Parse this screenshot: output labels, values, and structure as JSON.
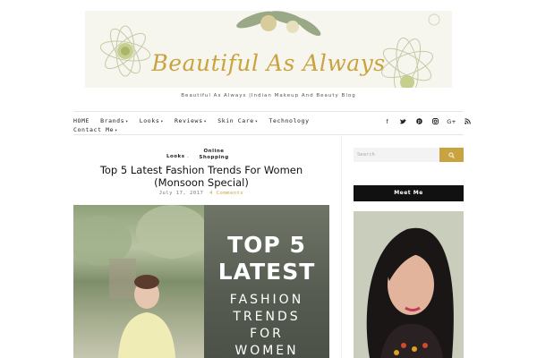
{
  "header": {
    "logo_title": "Beautiful As Always",
    "tagline": "Beautiful As Always |Indian Makeup And Beauty Blog"
  },
  "nav": {
    "row1": [
      {
        "label": "HOME",
        "dropdown": false
      },
      {
        "label": "Brands",
        "dropdown": true
      },
      {
        "label": "Looks",
        "dropdown": true
      },
      {
        "label": "Reviews",
        "dropdown": true
      },
      {
        "label": "Skin Care",
        "dropdown": true
      },
      {
        "label": "Technology",
        "dropdown": false
      }
    ],
    "row2": [
      {
        "label": "Contact Me",
        "dropdown": true
      }
    ],
    "social_icons": [
      "facebook-icon",
      "twitter-icon",
      "pinterest-icon",
      "instagram-icon",
      "google-plus-icon",
      "rss-icon"
    ]
  },
  "post": {
    "categories": [
      "Looks",
      "Online Shopping"
    ],
    "title": "Top 5 Latest Fashion Trends For Women (Monsoon Special)",
    "date": "July 17, 2017",
    "comments": "4 Comments",
    "image_text": [
      "TOP 5",
      "LATEST",
      "FASHION",
      "TRENDS",
      "FOR",
      "WOMEN"
    ]
  },
  "sidebar": {
    "search_placeholder": "Search",
    "meet_title": "Meet Me"
  },
  "colors": {
    "accent": "#c9a33f",
    "dark": "#111111",
    "search_bg": "#f3f3f3"
  }
}
